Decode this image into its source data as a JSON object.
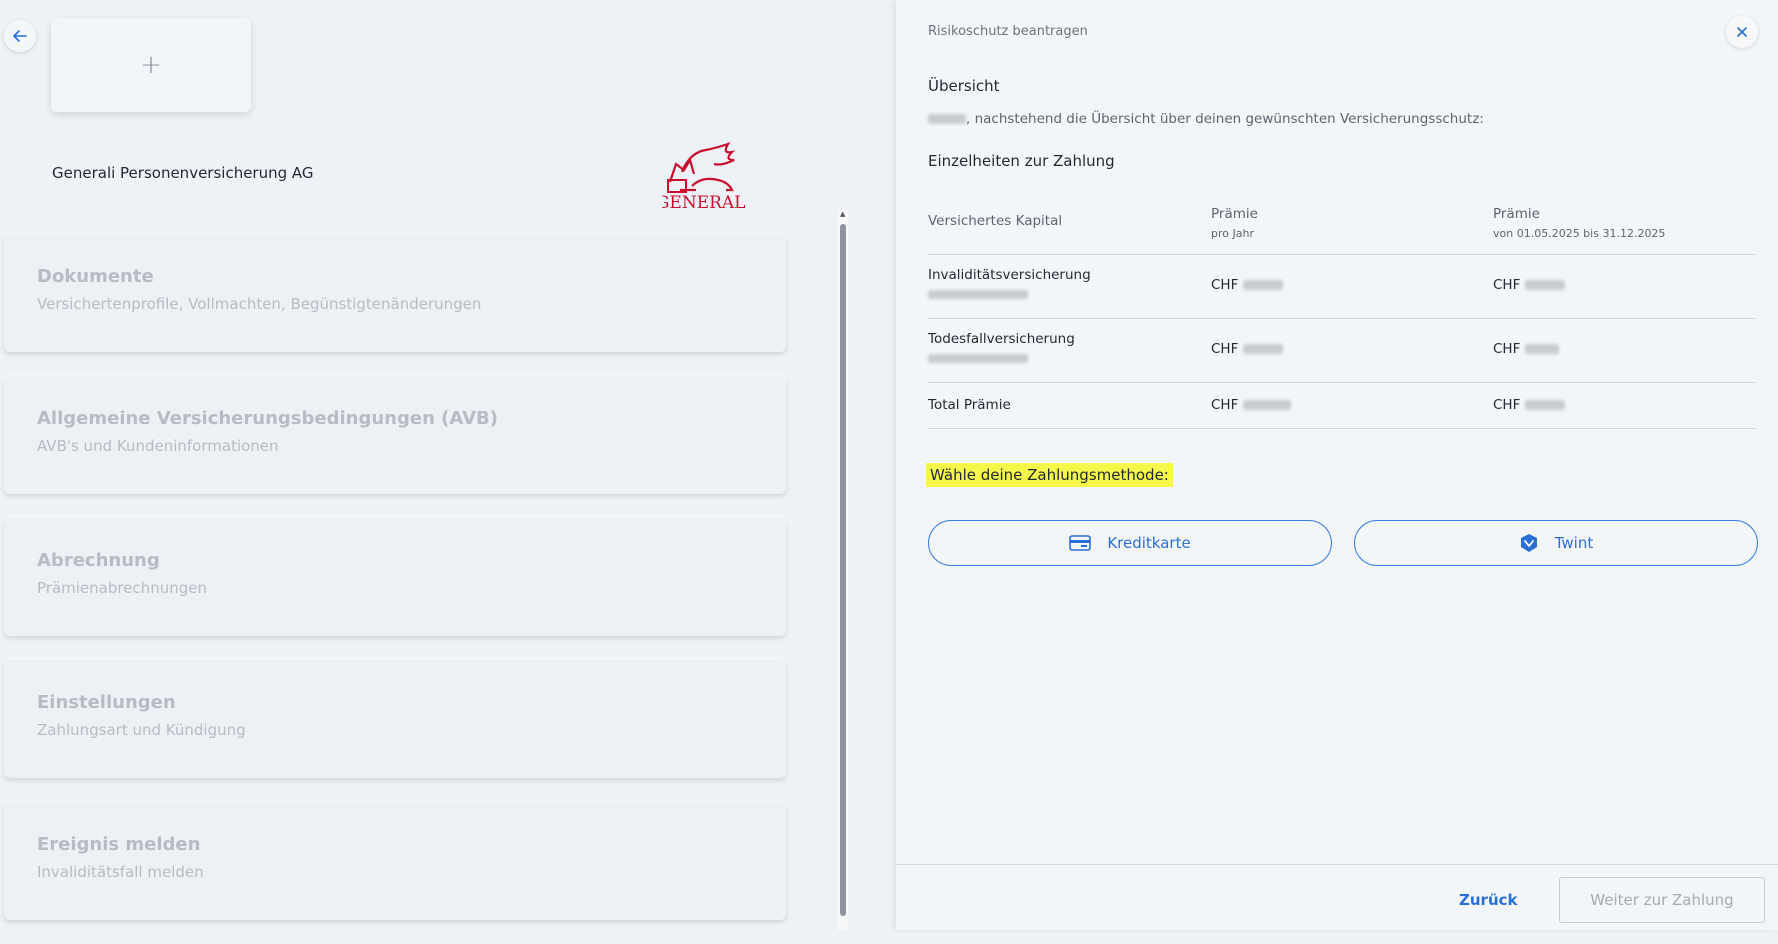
{
  "left_panel": {
    "add_symbol": "+",
    "company_name": "Generali Personenversicherung AG",
    "logo_text": "GENERALI",
    "menu": [
      {
        "title": "Dokumente",
        "subtitle": "Versichertenprofile, Vollmachten, Begünstigtenänderungen"
      },
      {
        "title": "Allgemeine Versicherungsbedingungen (AVB)",
        "subtitle": "AVB's und Kundeninformationen"
      },
      {
        "title": "Abrechnung",
        "subtitle": "Prämienabrechnungen"
      },
      {
        "title": "Einstellungen",
        "subtitle": "Zahlungsart und Kündigung"
      },
      {
        "title": "Ereignis melden",
        "subtitle": "Invaliditätsfall melden"
      }
    ]
  },
  "right_panel": {
    "title": "Risikoschutz beantragen",
    "overview_heading": "Übersicht",
    "overview_text": ", nachstehend die Übersicht über deinen gewünschten Versicherungsschutz:",
    "payment_details_heading": "Einzelheiten zur Zahlung",
    "table": {
      "headers": [
        {
          "label": "Versichertes Kapital",
          "sub": ""
        },
        {
          "label": "Prämie",
          "sub": "pro Jahr"
        },
        {
          "label": "Prämie",
          "sub": "von 01.05.2025 bis 31.12.2025"
        }
      ],
      "rows": [
        {
          "name": "Invaliditätsversicherung",
          "annual": "CHF",
          "period": "CHF"
        },
        {
          "name": "Todesfallversicherung",
          "annual": "CHF",
          "period": "CHF"
        },
        {
          "name": "Total Prämie",
          "annual": "CHF",
          "period": "CHF"
        }
      ]
    },
    "choose_payment": "Wähle deine Zahlungsmethode:",
    "payment_methods": [
      {
        "label": "Kreditkarte",
        "icon": "credit-card-icon"
      },
      {
        "label": "Twint",
        "icon": "twint-icon"
      }
    ],
    "footer": {
      "back_label": "Zurück",
      "next_label": "Weiter zur Zahlung"
    }
  },
  "colors": {
    "accent": "#2a6fd6",
    "highlight": "#f5f74a",
    "generali_red": "#c8102e"
  }
}
